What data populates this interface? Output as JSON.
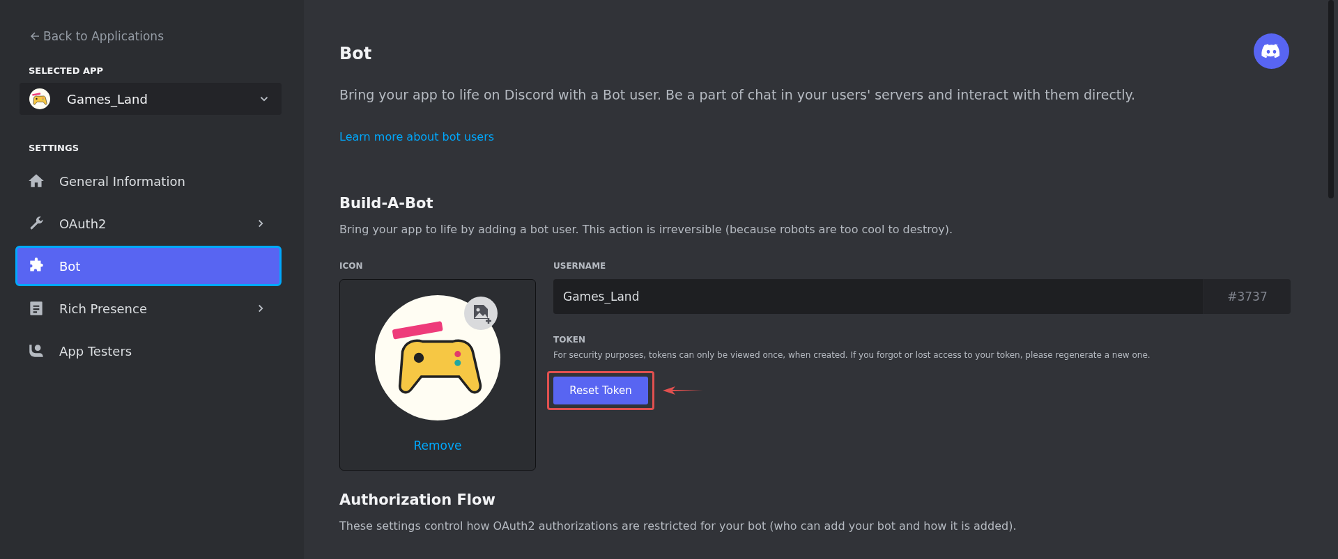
{
  "sidebar": {
    "back_link": "Back to Applications",
    "selected_app_label": "SELECTED APP",
    "selected_app": {
      "name": "Games_Land",
      "expanded": false
    },
    "settings_label": "SETTINGS",
    "items": [
      {
        "label": "General Information",
        "kind": "home",
        "has_submenu": false,
        "selected": false
      },
      {
        "label": "OAuth2",
        "kind": "wrench",
        "has_submenu": true,
        "selected": false
      },
      {
        "label": "Bot",
        "kind": "puzzle",
        "has_submenu": false,
        "selected": true
      },
      {
        "label": "Rich Presence",
        "kind": "document",
        "has_submenu": true,
        "selected": false
      },
      {
        "label": "App Testers",
        "kind": "person",
        "has_submenu": false,
        "selected": false
      }
    ]
  },
  "page": {
    "title": "Bot",
    "description": "Bring your app to life on Discord with a Bot user. Be a part of chat in your users' servers and interact with them directly.",
    "learn_more_link": "Learn more about bot users",
    "build_a_bot": {
      "title": "Build-A-Bot",
      "description": "Bring your app to life by adding a bot user. This action is irreversible (because robots are too cool to destroy).",
      "icon_label": "ICON",
      "remove_link": "Remove",
      "username_label": "USERNAME",
      "username": "Games_Land",
      "discriminator": "#3737",
      "token_label": "TOKEN",
      "token_note": "For security purposes, tokens can only be viewed once, when created. If you forgot or lost access to your token, please regenerate a new one.",
      "reset_token_button": "Reset Token"
    },
    "authorization_flow": {
      "title": "Authorization Flow",
      "description": "These settings control how OAuth2 authorizations are restricted for your bot (who can add your bot and how it is added)."
    }
  }
}
